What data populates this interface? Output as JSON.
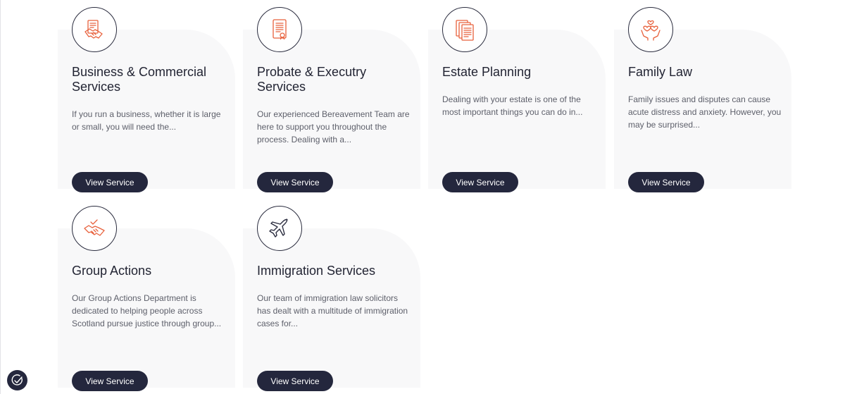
{
  "services": [
    {
      "icon": "handshake-document-icon",
      "title": "Business & Commercial Services",
      "description": "If you run a business, whether it is large or small, you will need the...",
      "button_label": "View Service"
    },
    {
      "icon": "certificate-document-icon",
      "title": "Probate & Executry Services",
      "description": "Our experienced Bereavement Team are here to support you throughout the process. Dealing with a...",
      "button_label": "View Service"
    },
    {
      "icon": "stacked-documents-icon",
      "title": "Estate Planning",
      "description": "Dealing with your estate is one of the most important things you can do in...",
      "button_label": "View Service"
    },
    {
      "icon": "hands-heart-icon",
      "title": "Family Law",
      "description": "Family issues and disputes can cause acute distress and anxiety. However, you may be surprised...",
      "button_label": "View Service"
    },
    {
      "icon": "handshake-check-icon",
      "title": "Group Actions",
      "description": "Our Group Actions Department is dedicated to helping people across Scotland pursue justice through group...",
      "button_label": "View Service"
    },
    {
      "icon": "airplane-icon",
      "title": "Immigration Services",
      "description": "Our team of immigration law solicitors has dealt with a multitude of immigration cases for...",
      "button_label": "View Service"
    }
  ],
  "accessibility": {
    "icon": "accessibility-check-icon"
  },
  "colors": {
    "accent": "#e8613c",
    "button_bg": "#24273d",
    "card_bg": "#f8f8f9",
    "text_dark": "#222433",
    "text_muted": "#5d5f6a"
  }
}
